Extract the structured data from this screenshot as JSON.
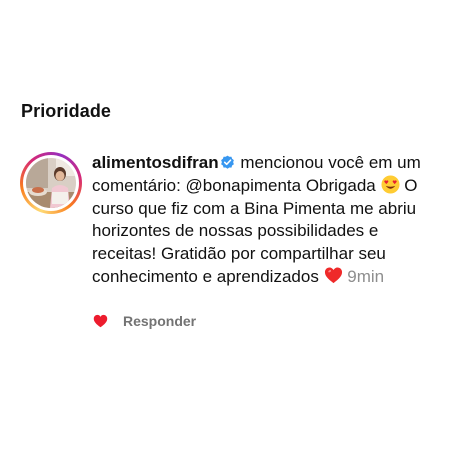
{
  "section": {
    "title": "Prioridade"
  },
  "notification": {
    "username": "alimentosdifran",
    "verified_icon": "verified-badge-icon",
    "action_text": " mencionou você em um comentário: ",
    "mention": "@bonapimenta",
    "comment_part1": " Obrigada ",
    "emoji1": "heart-eyes-emoji",
    "comment_part2": " O curso que fiz com a Bina Pimenta me abriu horizontes de nossas possibilidades e receitas! Gratidão por compartilhar seu conhecimento e aprendizados ",
    "emoji2": "red-heart-emoji",
    "time": "9min"
  },
  "actions": {
    "like_icon": "heart-icon",
    "reply_label": "Responder"
  },
  "colors": {
    "verified": "#3897f0",
    "like": "#ed1c2e",
    "muted": "#8e8e8e"
  }
}
